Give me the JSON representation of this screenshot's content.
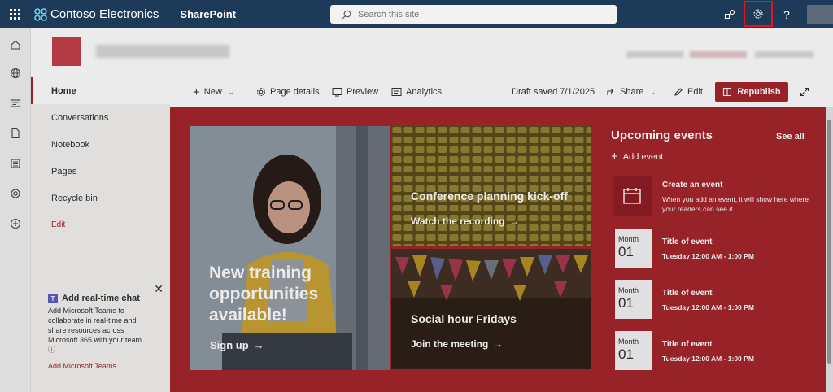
{
  "suitebar": {
    "brand": "Contoso Electronics",
    "app": "SharePoint",
    "search_placeholder": "Search this site"
  },
  "leftnav": {
    "items": [
      {
        "label": "Home"
      },
      {
        "label": "Conversations"
      },
      {
        "label": "Notebook"
      },
      {
        "label": "Pages"
      },
      {
        "label": "Recycle bin"
      },
      {
        "label": "Edit"
      }
    ]
  },
  "teams_card": {
    "title": "Add real-time chat",
    "description": "Add Microsoft Teams to collaborate in real-time and share resources across Microsoft 365 with your team.",
    "info": "ⓘ",
    "link": "Add Microsoft Teams"
  },
  "cmdbar": {
    "new": "New",
    "page_details": "Page details",
    "preview": "Preview",
    "analytics": "Analytics",
    "draft_status": "Draft saved 7/1/2025",
    "share": "Share",
    "edit": "Edit",
    "republish": "Republish"
  },
  "hero": {
    "main_title": "New training opportunities available!",
    "main_link": "Sign up",
    "tile1_title": "Conference planning kick-off",
    "tile1_link": "Watch the recording",
    "tile2_title": "Social hour Fridays",
    "tile2_link": "Join the meeting"
  },
  "events": {
    "title": "Upcoming events",
    "see_all": "See all",
    "add_event": "Add event",
    "create_title": "Create an event",
    "create_desc": "When you add an event, it will show here where your readers can see it.",
    "items": [
      {
        "month": "Month",
        "day": "01",
        "title": "Title of event",
        "time": "Tuesday 12:00 AM - 1:00 PM"
      },
      {
        "month": "Month",
        "day": "01",
        "title": "Title of event",
        "time": "Tuesday 12:00 AM - 1:00 PM"
      },
      {
        "month": "Month",
        "day": "01",
        "title": "Title of event",
        "time": "Tuesday 12:00 AM - 1:00 PM"
      }
    ]
  },
  "colors": {
    "suitebar": "#1e3a59",
    "accent": "#a4262c",
    "highlight": "#e81123"
  }
}
